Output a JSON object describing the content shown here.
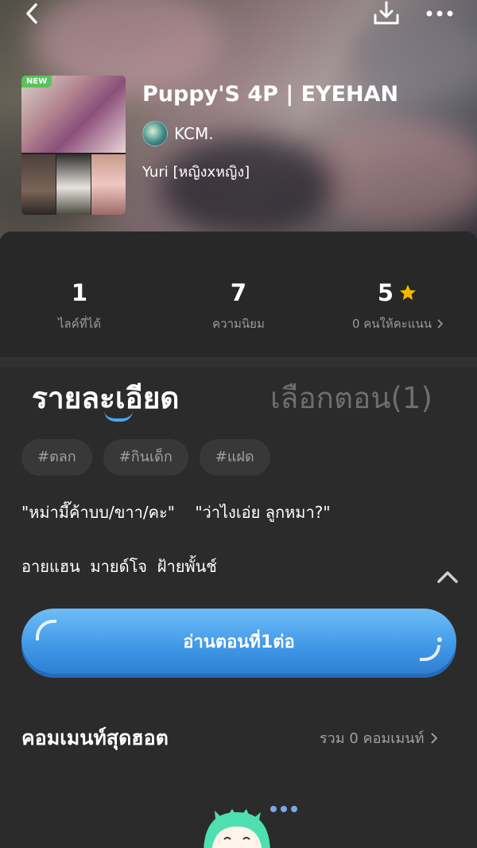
{
  "header": {
    "back_icon": "chevron-left-icon",
    "download_icon": "download-icon",
    "more_icon": "more-dots-icon"
  },
  "story": {
    "badge": "NEW",
    "title": "Puppy'S 4P | EYEHAN",
    "author": "KCM.",
    "genre": "Yuri [หญิงxหญิง]"
  },
  "stats": [
    {
      "value": "1",
      "label": "ไลค์ที่ได้"
    },
    {
      "value": "7",
      "label": "ความนิยม"
    },
    {
      "value": "5",
      "label": "0 คนให้คะแนน"
    }
  ],
  "tabs": {
    "active": "รายละเอียด",
    "inactive": "เลือกตอน(1)"
  },
  "tags": [
    "#ตลก",
    "#กินเด็ก",
    "#แฝด"
  ],
  "description": {
    "line1": "\"หม่ามี๊ค้าบบ/ขาา/คะ\"    \"ว่าไงเอ่ย ลูกหมา?\"",
    "line2": "อายแฮน  มายด์โจ  ฝ้ายพั้นช์"
  },
  "read_button": "อ่านตอนที่1ต่อ",
  "comments": {
    "title": "คอมเมนท์สุดฮอต",
    "total": "รวม 0 คอมเมนท์"
  },
  "colors": {
    "accent": "#4aa7ee",
    "star": "#f6b700",
    "new_badge": "#5ac25a"
  }
}
